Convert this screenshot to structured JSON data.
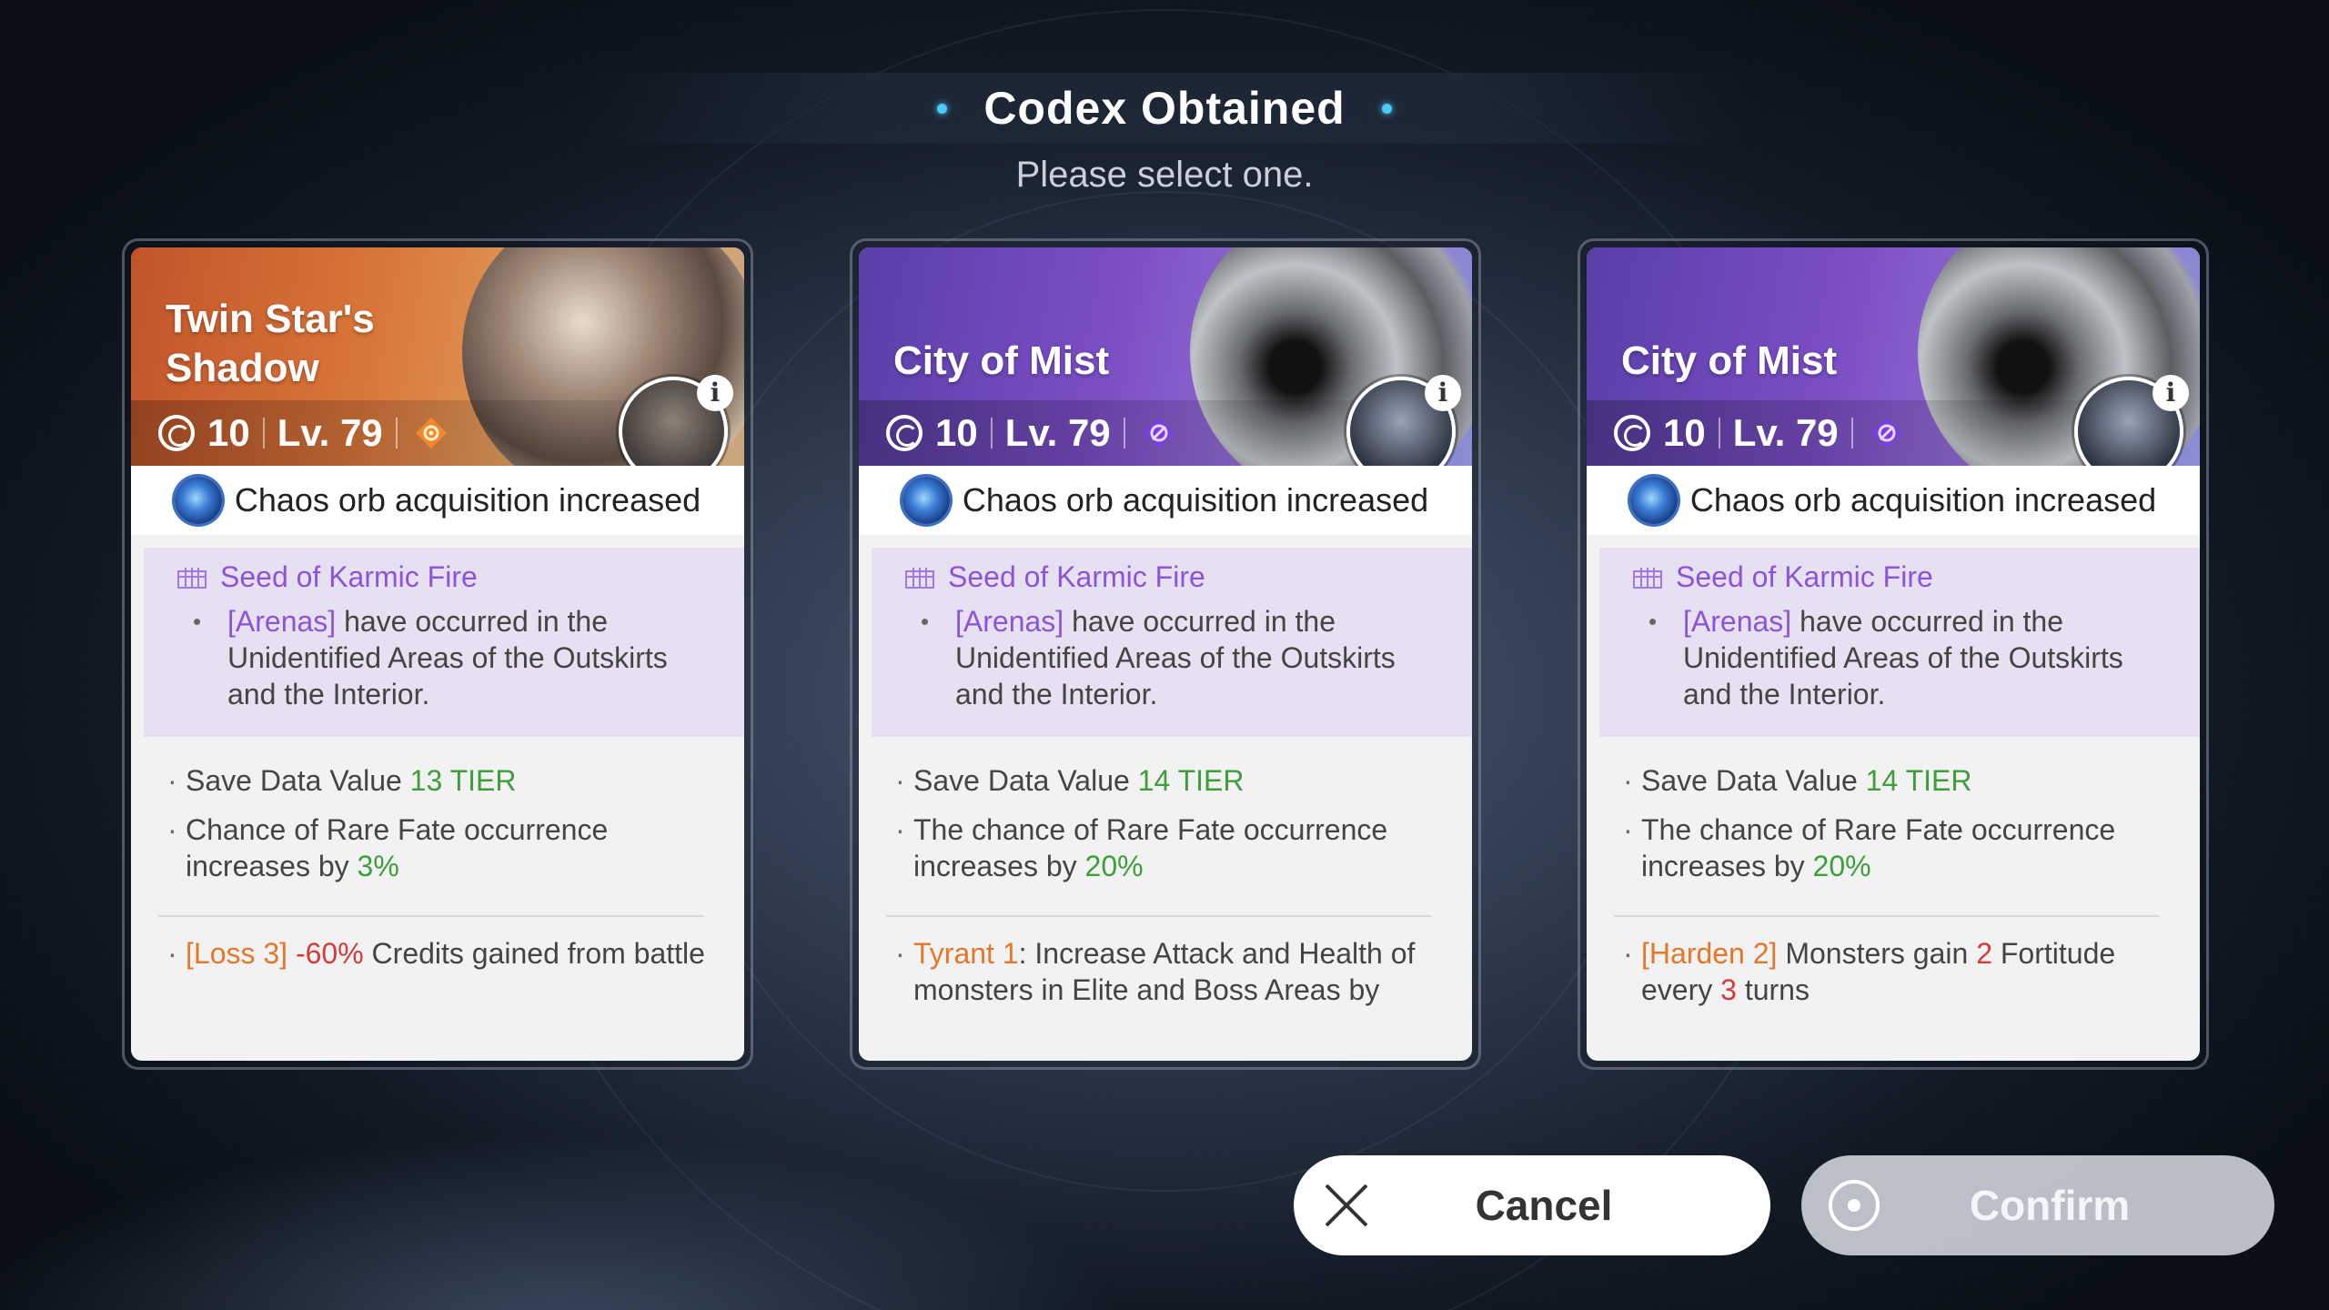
{
  "header": {
    "title": "Codex Obtained",
    "subtitle": "Please select one."
  },
  "cards": [
    {
      "theme": "orange",
      "title": "Twin Star's Shadow",
      "level_count": "10",
      "level": "Lv. 79",
      "element_icon": "sun-emblem-icon",
      "bonus": "Chaos orb acquisition increased",
      "seed_title": "Seed of Karmic Fire",
      "seed_highlight": "[Arenas]",
      "seed_text": " have occurred in the Unidentified Areas of the Outskirts and the Interior.",
      "save_label": "Save Data Value ",
      "save_value": "13 TIER",
      "chance_text": "Chance of Rare Fate occurrence increases by ",
      "chance_value": "3%",
      "curse_tag": "[Loss 3]",
      "curse_value": " -60%",
      "curse_text": " Credits gained from battle"
    },
    {
      "theme": "purple",
      "title": "City of Mist",
      "level_count": "10",
      "level": "Lv. 79",
      "element_icon": "void-emblem-icon",
      "bonus": "Chaos orb acquisition increased",
      "seed_title": "Seed of Karmic Fire",
      "seed_highlight": "[Arenas]",
      "seed_text": " have occurred in the Unidentified Areas of the Outskirts and the Interior.",
      "save_label": "Save Data Value ",
      "save_value": "14 TIER",
      "chance_text": "The chance of Rare Fate occurrence increases by ",
      "chance_value": "20%",
      "curse_tag": "Tyrant 1",
      "curse_text": ": Increase Attack and Health of monsters in Elite and Boss Areas by"
    },
    {
      "theme": "purple",
      "title": "City of Mist",
      "level_count": "10",
      "level": "Lv. 79",
      "element_icon": "void-emblem-icon",
      "bonus": "Chaos orb acquisition increased",
      "seed_title": "Seed of Karmic Fire",
      "seed_highlight": "[Arenas]",
      "seed_text": " have occurred in the Unidentified Areas of the Outskirts and the Interior.",
      "save_label": "Save Data Value ",
      "save_value": "14 TIER",
      "chance_text": "The chance of Rare Fate occurrence increases by ",
      "chance_value": "20%",
      "curse_tag": "[Harden 2]",
      "curse_text_1": " Monsters gain ",
      "curse_num_1": "2",
      "curse_text_2": " Fortitude every ",
      "curse_num_2": "3",
      "curse_text_3": " turns"
    }
  ],
  "buttons": {
    "cancel": "Cancel",
    "confirm": "Confirm"
  },
  "colors": {
    "accent_purple": "#8a55d8",
    "value_green": "#3f9e3c",
    "curse_orange": "#e5772b",
    "curse_red": "#d63b3b",
    "title_dot": "#4fc8ff"
  }
}
